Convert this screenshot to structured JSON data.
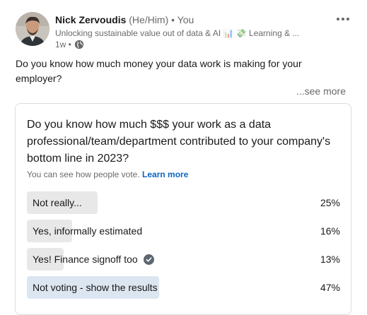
{
  "author": {
    "name": "Nick Zervoudis",
    "pronouns": "(He/Him)",
    "relation": "• You",
    "headline": "Unlocking sustainable value out of data & AI 📊 💸 Learning & ...",
    "time": "1w •"
  },
  "post": {
    "text": "Do you know how much money your data work is making for your employer?",
    "see_more": "...see more"
  },
  "poll": {
    "question": "Do you know how much $$$ your work as a data professional/team/department contributed to your company's bottom line in 2023?",
    "note": "You can see how people vote.",
    "learn_more": "Learn more",
    "options": [
      {
        "label": "Not really...",
        "percent": "25%",
        "share": 0.25,
        "selected": false
      },
      {
        "label": "Yes, informally estimated",
        "percent": "16%",
        "share": 0.16,
        "selected": false
      },
      {
        "label": "Yes! Finance signoff too",
        "percent": "13%",
        "share": 0.13,
        "selected": false,
        "icon": "check-circle-icon"
      },
      {
        "label": "Not voting - show the results",
        "percent": "47%",
        "share": 0.47,
        "selected": true
      }
    ]
  },
  "colors": {
    "bar": "#e8e8e8",
    "bar_selected": "#dce6f1",
    "link": "#0a66c2"
  }
}
